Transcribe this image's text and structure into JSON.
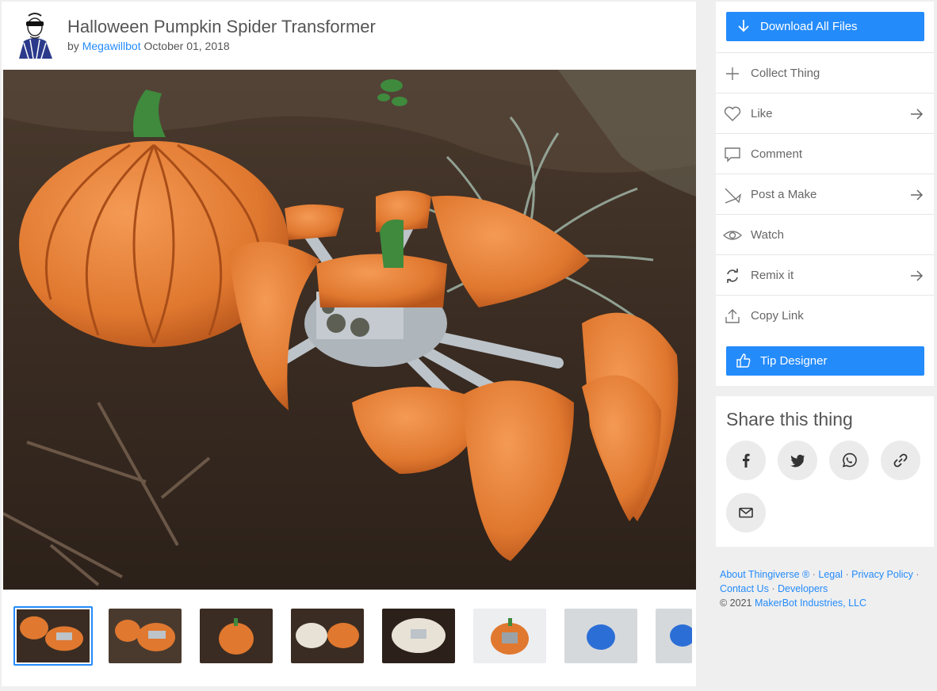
{
  "thing": {
    "title": "Halloween Pumpkin Spider Transformer",
    "by_prefix": "by",
    "author": "Megawillbot",
    "date": "October 01, 2018"
  },
  "gallery": {
    "thumbnails": [
      {
        "name": "thumbnail-1",
        "active": true
      },
      {
        "name": "thumbnail-2",
        "active": false
      },
      {
        "name": "thumbnail-3",
        "active": false
      },
      {
        "name": "thumbnail-4",
        "active": false
      },
      {
        "name": "thumbnail-5",
        "active": false
      },
      {
        "name": "thumbnail-6",
        "active": false
      },
      {
        "name": "thumbnail-7",
        "active": false
      },
      {
        "name": "thumbnail-8",
        "active": false
      }
    ]
  },
  "actions": {
    "download_label": "Download All Files",
    "collect_label": "Collect Thing",
    "like_label": "Like",
    "comment_label": "Comment",
    "post_make_label": "Post a Make",
    "watch_label": "Watch",
    "remix_label": "Remix it",
    "copy_link_label": "Copy Link",
    "tip_label": "Tip Designer"
  },
  "share": {
    "title": "Share this thing",
    "buttons": [
      "facebook-icon",
      "twitter-icon",
      "whatsapp-icon",
      "link-icon",
      "mail-icon"
    ]
  },
  "footer": {
    "about": "About Thingiverse",
    "registered": "®",
    "legal": "Legal",
    "privacy": "Privacy Policy",
    "contact": "Contact Us",
    "developers": "Developers",
    "copyright_prefix": "©  2021",
    "company": "MakerBot Industries, LLC",
    "separator": "·"
  },
  "colors": {
    "accent": "#248bfb",
    "page_bg": "#efefef",
    "pumpkin": "#e0782f",
    "stem": "#3f8a3d",
    "soil": "#3a2c22"
  }
}
